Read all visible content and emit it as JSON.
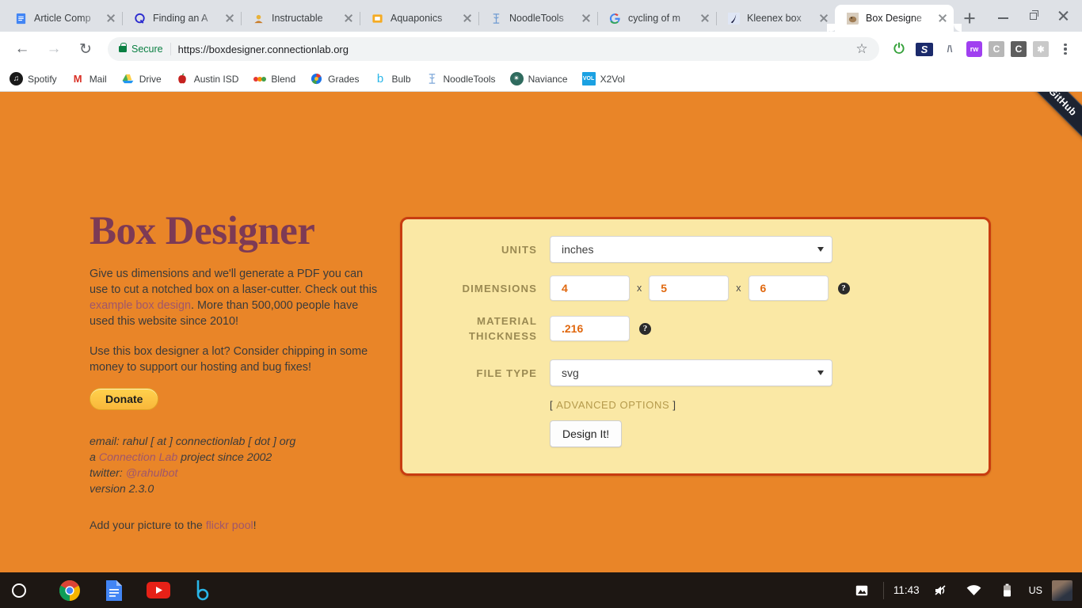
{
  "browser": {
    "tabs": [
      {
        "title": "Article Comp",
        "favicon": "docs-icon",
        "active": false
      },
      {
        "title": "Finding an A",
        "favicon": "quora-icon",
        "active": false
      },
      {
        "title": "Instructable",
        "favicon": "instructables-icon",
        "active": false
      },
      {
        "title": "Aquaponics",
        "favicon": "folder-icon",
        "active": false
      },
      {
        "title": "NoodleTools",
        "favicon": "noodletools-icon",
        "active": false
      },
      {
        "title": "cycling of m",
        "favicon": "google-icon",
        "active": false
      },
      {
        "title": "Kleenex box",
        "favicon": "sketch-icon",
        "active": false
      },
      {
        "title": "Box Designe",
        "favicon": "boxdesigner-icon",
        "active": true
      }
    ],
    "new_tab_label": "+",
    "window_controls": {
      "minimize": "minimize-icon",
      "maximize": "restore-icon",
      "close": "close-icon"
    },
    "nav": {
      "back": "back-arrow-icon",
      "forward": "forward-arrow-icon",
      "reload": "reload-icon"
    },
    "omnibox": {
      "security_label": "Secure",
      "url": "https://boxdesigner.connectionlab.org",
      "lock": "lock-icon",
      "bookmark_star": "star-icon"
    },
    "extensions": [
      {
        "name": "power-extension",
        "glyph": "⏻",
        "color": "#35a13a",
        "bg": "transparent"
      },
      {
        "name": "s-extension",
        "glyph": "S",
        "color": "#1b2a6b",
        "bg": "transparent"
      },
      {
        "name": "lambda-extension",
        "glyph": "/\\",
        "color": "#6b7280",
        "bg": "transparent"
      },
      {
        "name": "rw-extension",
        "glyph": "rw",
        "color": "#ffffff",
        "bg": "#a040f0"
      },
      {
        "name": "c-extension-light",
        "glyph": "C",
        "color": "#ffffff",
        "bg": "#b7b7b7"
      },
      {
        "name": "c-extension-dark",
        "glyph": "C",
        "color": "#ffffff",
        "bg": "#5e5e5e"
      },
      {
        "name": "grey-extension",
        "glyph": "✱",
        "color": "#ffffff",
        "bg": "#c3c3c3"
      }
    ],
    "menu": "kebab-menu-icon",
    "bookmarks": [
      {
        "label": "Spotify",
        "icon": "spotify-icon",
        "glyph": "♫",
        "color": "#ffffff",
        "bg": "#1a1a1a"
      },
      {
        "label": "Mail",
        "icon": "gmail-icon",
        "glyph": "M",
        "color": "#d93025",
        "bg": "transparent"
      },
      {
        "label": "Drive",
        "icon": "drive-icon",
        "glyph": "▲",
        "color": "#f9ab00",
        "bg": "transparent"
      },
      {
        "label": "Austin ISD",
        "icon": "apple-icon",
        "glyph": "●",
        "color": "#c5221f",
        "bg": "transparent"
      },
      {
        "label": "Blend",
        "icon": "blend-icon",
        "glyph": "❖",
        "color": "#e8710a",
        "bg": "transparent"
      },
      {
        "label": "Grades",
        "icon": "grades-icon",
        "glyph": "●",
        "color": "#1a73e8",
        "bg": "transparent"
      },
      {
        "label": "Bulb",
        "icon": "bulb-icon",
        "glyph": "b",
        "color": "#2ab6e8",
        "bg": "transparent"
      },
      {
        "label": "NoodleTools",
        "icon": "noodletools-icon",
        "glyph": "Ψ",
        "color": "#7da7d9",
        "bg": "transparent"
      },
      {
        "label": "Naviance",
        "icon": "naviance-icon",
        "glyph": "✴",
        "color": "#ffffff",
        "bg": "#2f6b5e"
      },
      {
        "label": "X2Vol",
        "icon": "x2vol-icon",
        "glyph": "VOL",
        "color": "#ffffff",
        "bg": "#1ba1e2"
      }
    ]
  },
  "page": {
    "ribbon": "Fork me on GitHub",
    "title": "Box Designer",
    "intro_1": "Give us dimensions and we'll generate a PDF you can use to cut a notched box on a laser-cutter. Check out this ",
    "intro_link": "example box design",
    "intro_2": ". More than 500,000 people have used this website since 2010!",
    "support": "Use this box designer a lot? Consider chipping in some money to support our hosting and bug fixes!",
    "donate_label": "Donate",
    "email_line": "email: rahul [ at ] connectionlab [ dot ] org",
    "project_prefix": "a ",
    "project_link": "Connection Lab",
    "project_suffix": " project since 2002",
    "twitter_label": "twitter: ",
    "twitter_handle": "@rahulbot",
    "version": "version 2.3.0",
    "flickr_prefix": "Add your picture to the ",
    "flickr_link": "flickr pool",
    "flickr_suffix": "!"
  },
  "form": {
    "units": {
      "label": "UNITS",
      "value": "inches"
    },
    "dimensions": {
      "label": "DIMENSIONS",
      "length": "4",
      "width": "5",
      "height": "6",
      "separator": "x",
      "help": "?"
    },
    "material_thickness": {
      "label_line1": "MATERIAL",
      "label_line2": "THICKNESS",
      "value": ".216",
      "help": "?"
    },
    "file_type": {
      "label": "FILE TYPE",
      "value": "svg"
    },
    "advanced": {
      "open_bracket": "[",
      "label": "ADVANCED OPTIONS",
      "close_bracket": "]"
    },
    "submit_label": "Design It!"
  },
  "shelf": {
    "launcher": "launcher-icon",
    "apps": [
      {
        "name": "chrome-icon"
      },
      {
        "name": "google-docs-icon"
      },
      {
        "name": "youtube-icon"
      },
      {
        "name": "bulb-icon"
      }
    ],
    "tray": {
      "screenshot": "image-icon",
      "time": "11:43",
      "volume": "volume-muted-icon",
      "wifi": "wifi-icon",
      "battery": "battery-icon",
      "locale": "US",
      "avatar": "user-avatar"
    }
  },
  "colors": {
    "page_bg": "#e98528",
    "panel_bg": "#fae8a5",
    "panel_border": "#c83c10",
    "title": "#7d3a55",
    "label": "#9b8a52",
    "input_text": "#e0680f",
    "link": "#a0566b"
  }
}
